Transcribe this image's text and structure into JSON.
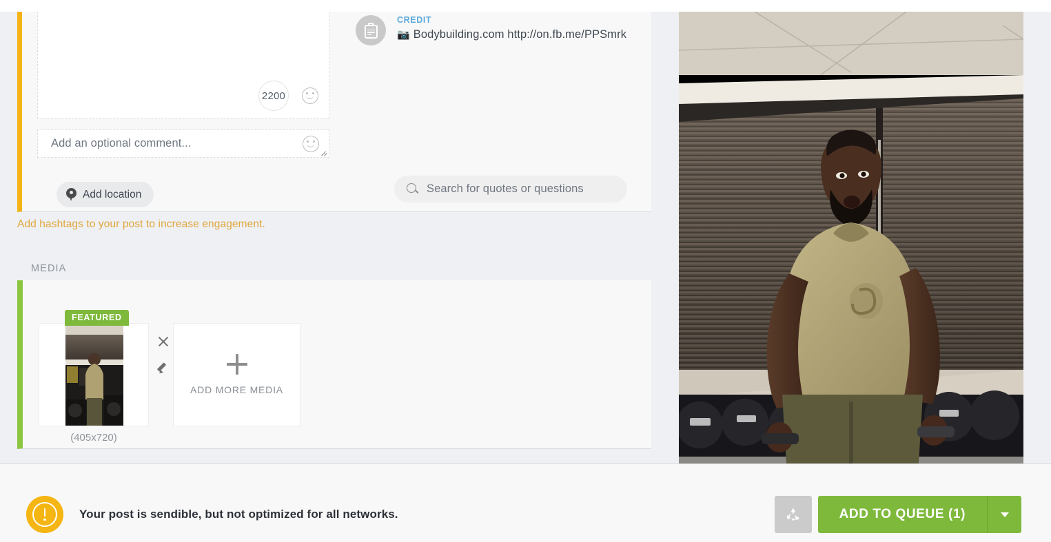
{
  "composer": {
    "character_counter": "2200",
    "comment_placeholder": "Add an optional comment...",
    "location_button": "Add location",
    "emoji_icon": "smiley-face-icon",
    "resize_handle": "textarea-resize-grip"
  },
  "credit": {
    "label": "CREDIT",
    "camera_emoji": "📷",
    "text": "Bodybuilding.com http://on.fb.me/PPSmrk",
    "icon": "clipboard-icon"
  },
  "quote_search": {
    "placeholder": "Search for quotes or questions",
    "icon": "search-icon"
  },
  "hints": {
    "hashtag_hint": "Add hashtags to your post to increase engagement."
  },
  "media": {
    "section_label": "MEDIA",
    "featured_badge": "FEATURED",
    "thumbnail_dimensions": "(405x720)",
    "remove_icon": "close-icon",
    "edit_icon": "pencil-icon",
    "add_more_label": "ADD MORE MEDIA",
    "add_icon": "plus-icon"
  },
  "action_bar": {
    "status_message": "Your post is sendible, but not optimized for all networks.",
    "status_icon": "warning-exclamation-icon",
    "recycle_icon": "recycle-icon",
    "primary_button": "ADD TO QUEUE (1)",
    "dropdown_icon": "chevron-down-icon"
  },
  "colors": {
    "accent_warning": "#f5b315",
    "accent_success": "#8cc53f",
    "brand_green": "#7eb93c",
    "credit_blue": "#5aa9dd",
    "hint_orange": "#e0a63b",
    "page_background": "#eef0f4",
    "panel_background": "#f8f8f8"
  }
}
